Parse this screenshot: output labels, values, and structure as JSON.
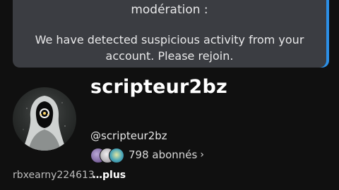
{
  "dialog": {
    "heading_fragment": "modération :",
    "message": "We have detected suspicious activity from your account. Please rejoin.",
    "accent_color": "#2c8fe6"
  },
  "profile": {
    "display_name": "scripteur2bz",
    "handle": "@scripteur2bz",
    "avatar_icon": "hooded-figure-avatar",
    "followers_label": "798 abonnés",
    "followers_chevron": "›",
    "bio_preview": "rbxearny224613",
    "more_label": "…plus"
  }
}
